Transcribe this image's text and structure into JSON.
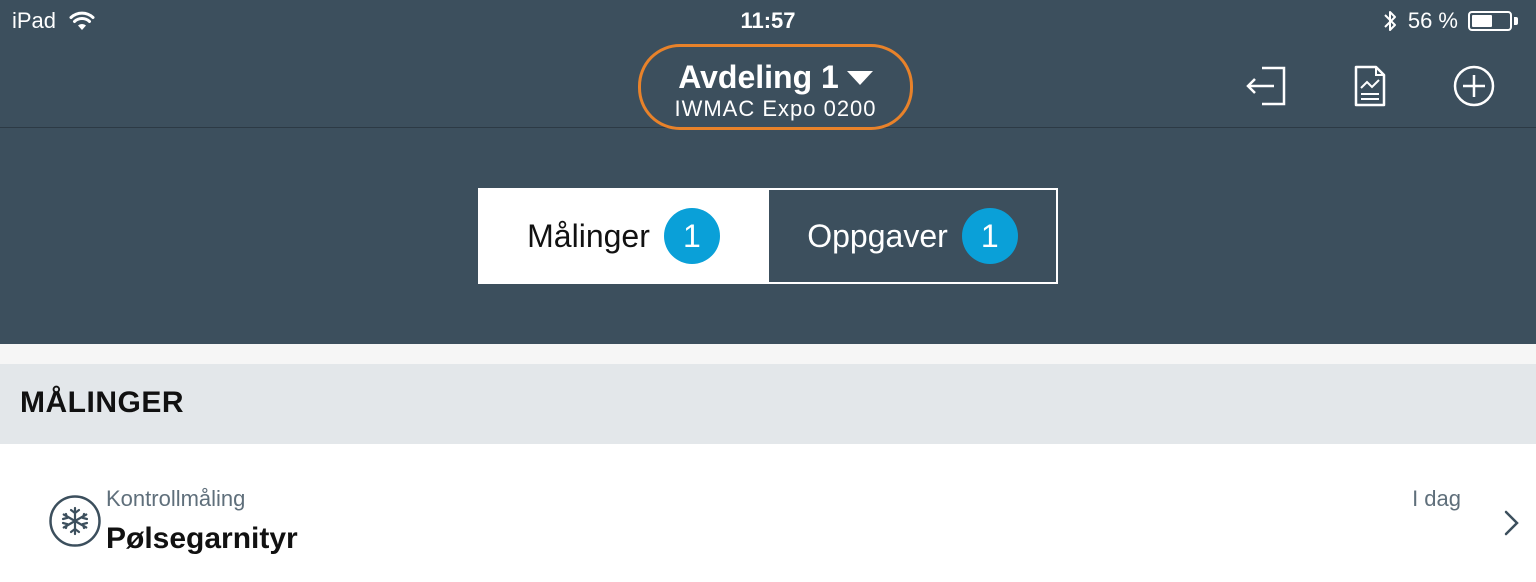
{
  "status_bar": {
    "device": "iPad",
    "time": "11:57",
    "battery_text": "56 %",
    "battery_level": 0.56
  },
  "nav": {
    "title": "Avdeling 1",
    "subtitle": "IWMAC Expo 0200",
    "highlight_color": "#e8822a"
  },
  "segments": [
    {
      "label": "Målinger",
      "count": "1",
      "active": true
    },
    {
      "label": "Oppgaver",
      "count": "1",
      "active": false
    }
  ],
  "section": {
    "title": "MÅLINGER"
  },
  "items": [
    {
      "category": "Kontrollmåling",
      "title": "Pølsegarnityr",
      "date": "I dag",
      "icon": "snowflake-icon"
    }
  ],
  "colors": {
    "header_bg": "#3c4f5d",
    "badge": "#0aa0d8",
    "section_bg": "#e3e7ea"
  }
}
